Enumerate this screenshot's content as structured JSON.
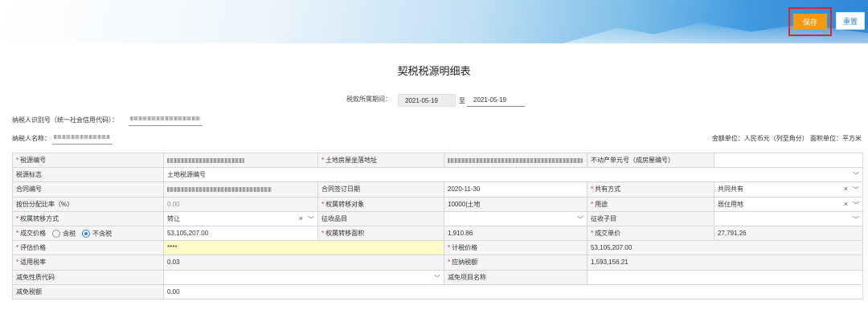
{
  "toolbar": {
    "save_label": "保存",
    "reset_label": "重置"
  },
  "page_title": "契税税源明细表",
  "period": {
    "label": "税款所属期间：",
    "start": "2021-05-19",
    "separator": "至",
    "end": "2021-05-19"
  },
  "taxpayer": {
    "id_label": "纳税人识别号（统一社会信用代码）：",
    "name_label": "纳税人名称："
  },
  "units_note": "金额单位：人民币元（列至角分） 面积单位：平方米",
  "form": {
    "source_no_label": "税源编号",
    "land_location_label": "土地房屋坐落地址",
    "real_estate_unit_label": "不动产单元号（成房屋编号）",
    "source_flag_label": "税源标志",
    "source_flag_value": "土地税源编号",
    "contract_no_label": "合同编号",
    "contract_date_label": "合同签订日期",
    "contract_date_value": "2020-11-30",
    "co_ownership_label": "共有方式",
    "co_ownership_value": "共同共有",
    "share_ratio_label": "按份分配比率（%）",
    "share_ratio_value": "0.00",
    "transfer_object_label": "权属转移对象",
    "transfer_object_value": "10000|土地",
    "usage_label": "用途",
    "usage_value": "居住用地",
    "transfer_method_label": "权属转移方式",
    "transfer_method_value": "转让",
    "levy_item_label": "征收品目",
    "levy_subitem_label": "征收子目",
    "deal_price_label": "成交价格",
    "radio_incl_label": "含税",
    "radio_excl_label": "不含税",
    "deal_price_value": "53,105,207.00",
    "transfer_area_label": "权属转移面积",
    "transfer_area_value": "1,910.86",
    "unit_price_label": "成交单价",
    "unit_price_value": "27,791.26",
    "assess_price_label": "评估价格",
    "assess_price_value": "****",
    "tax_price_label": "计税价格",
    "tax_price_value": "53,105,207.00",
    "tax_rate_label": "适用税率",
    "tax_rate_value": "0.03",
    "payable_label": "应纳税额",
    "payable_value": "1,593,156.21",
    "relief_code_label": "减免性质代码",
    "relief_item_label": "减免项目名称",
    "relief_amount_label": "减免税额",
    "relief_amount_value": "0.00"
  }
}
